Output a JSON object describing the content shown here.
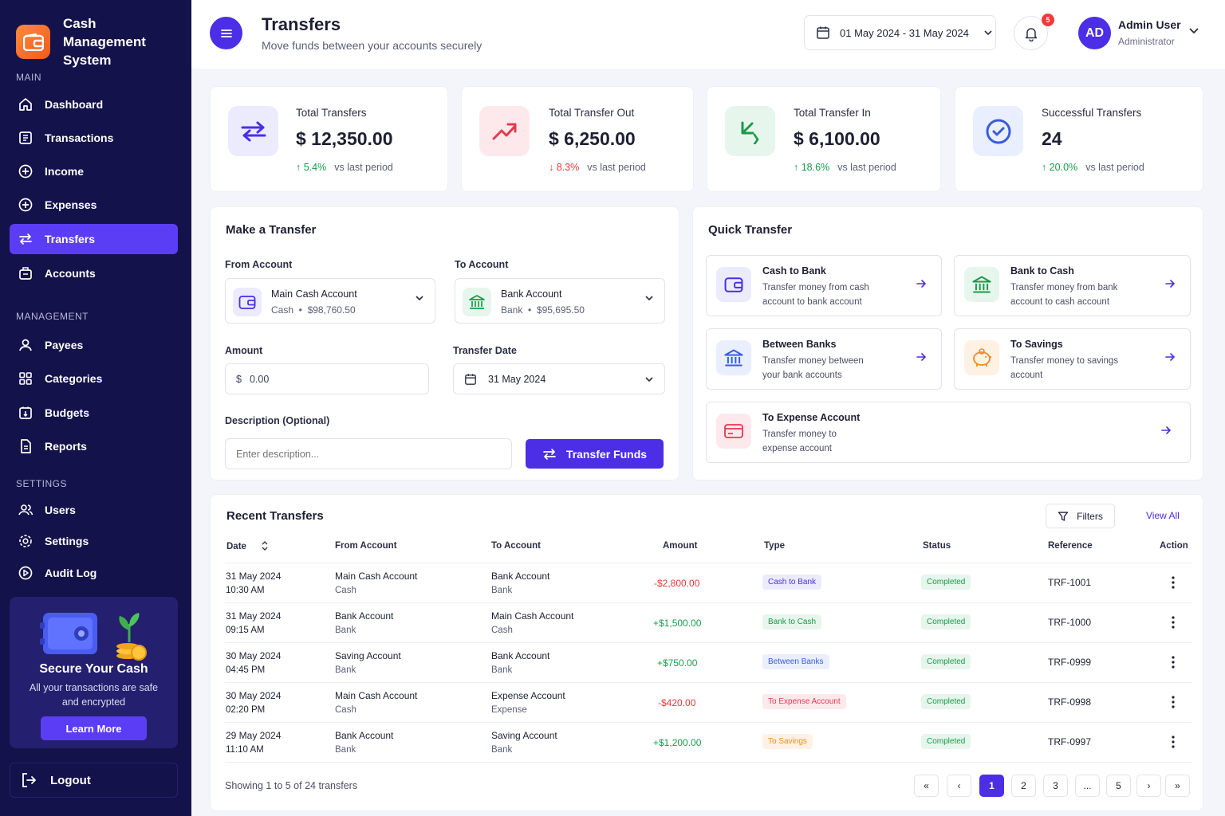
{
  "brand": {
    "name_line1": "Cash Management",
    "name_line2": "System"
  },
  "sidebar": {
    "sections": [
      "MAIN",
      "MANAGEMENT",
      "SETTINGS"
    ],
    "items": [
      {
        "label": "Dashboard",
        "icon": "home-icon"
      },
      {
        "label": "Transactions",
        "icon": "receipt-icon"
      },
      {
        "label": "Income",
        "icon": "plus-circle-icon"
      },
      {
        "label": "Expenses",
        "icon": "plus-circle-icon"
      },
      {
        "label": "Transfers",
        "icon": "transfer-icon",
        "active": true
      },
      {
        "label": "Accounts",
        "icon": "briefcase-icon"
      },
      {
        "label": "Payees",
        "icon": "user-icon"
      },
      {
        "label": "Categories",
        "icon": "grid-icon"
      },
      {
        "label": "Budgets",
        "icon": "budget-icon"
      },
      {
        "label": "Reports",
        "icon": "report-icon"
      },
      {
        "label": "Users",
        "icon": "users-icon"
      },
      {
        "label": "Settings",
        "icon": "gear-icon"
      },
      {
        "label": "Audit Log",
        "icon": "play-circle-icon"
      }
    ],
    "promo": {
      "title": "Secure Your Cash",
      "text": "All your transactions are safe and encrypted",
      "button": "Learn More"
    },
    "logout": "Logout"
  },
  "header": {
    "title": "Transfers",
    "subtitle": "Move funds between your accounts securely",
    "date_range": "01 May 2024 - 31 May 2024",
    "notification_count": "5",
    "user": {
      "initials": "AD",
      "name": "Admin User",
      "role": "Administrator"
    }
  },
  "stats": [
    {
      "label": "Total Transfers",
      "value": "$ 12,350.00",
      "change": "5.4%",
      "direction": "up",
      "vs": "vs last period",
      "icon": "swap-icon"
    },
    {
      "label": "Total Transfer Out",
      "value": "$ 6,250.00",
      "change": "8.3%",
      "direction": "down",
      "vs": "vs last period",
      "icon": "trending-up-icon"
    },
    {
      "label": "Total Transfer In",
      "value": "$ 6,100.00",
      "change": "18.6%",
      "direction": "up",
      "vs": "vs last period",
      "icon": "arrow-in-icon"
    },
    {
      "label": "Successful Transfers",
      "value": "24",
      "change": "20.0%",
      "direction": "up",
      "vs": "vs last period",
      "icon": "check-circle-icon"
    }
  ],
  "transfer_form": {
    "title": "Make a Transfer",
    "from_label": "From Account",
    "from": {
      "name": "Main Cash Account",
      "type": "Cash",
      "balance": "$98,760.50"
    },
    "to_label": "To Account",
    "to": {
      "name": "Bank Account",
      "type": "Bank",
      "balance": "$95,695.50"
    },
    "amount_label": "Amount",
    "currency": "$",
    "amount_value": "0.00",
    "date_label": "Transfer Date",
    "date_value": "31 May 2024",
    "desc_label": "Description (Optional)",
    "desc_placeholder": "Enter description...",
    "submit": "Transfer Funds"
  },
  "quick_transfer": {
    "title": "Quick Transfer",
    "items": [
      {
        "title": "Cash to Bank",
        "desc": "Transfer money from cash account to bank account",
        "icon": "wallet-icon"
      },
      {
        "title": "Bank to Cash",
        "desc": "Transfer money from bank account to cash account",
        "icon": "bank-icon"
      },
      {
        "title": "Between Banks",
        "desc": "Transfer money between your bank accounts",
        "icon": "bank-icon"
      },
      {
        "title": "To Savings",
        "desc": "Transfer money to savings account",
        "icon": "piggy-bank-icon"
      },
      {
        "title": "To Expense Account",
        "desc": "Transfer money to expense account",
        "icon": "card-icon"
      }
    ]
  },
  "recent": {
    "title": "Recent Transfers",
    "filters": "Filters",
    "view_all": "View All",
    "columns": [
      "Date",
      "From Account",
      "To Account",
      "Amount",
      "Type",
      "Status",
      "Reference",
      "Action"
    ],
    "rows": [
      {
        "date": "31 May 2024",
        "time": "10:30 AM",
        "from": "Main Cash Account",
        "from_type": "Cash",
        "to": "Bank Account",
        "to_type": "Bank",
        "amount": "-$2,800.00",
        "type": "Cash to Bank",
        "status": "Completed",
        "ref": "TRF-1001"
      },
      {
        "date": "31 May 2024",
        "time": "09:15 AM",
        "from": "Bank Account",
        "from_type": "Bank",
        "to": "Main Cash Account",
        "to_type": "Cash",
        "amount": "+$1,500.00",
        "type": "Bank to Cash",
        "status": "Completed",
        "ref": "TRF-1000"
      },
      {
        "date": "30 May 2024",
        "time": "04:45 PM",
        "from": "Saving Account",
        "from_type": "Bank",
        "to": "Bank Account",
        "to_type": "Bank",
        "amount": "+$750.00",
        "type": "Between Banks",
        "status": "Completed",
        "ref": "TRF-0999"
      },
      {
        "date": "30 May 2024",
        "time": "02:20 PM",
        "from": "Main Cash Account",
        "from_type": "Cash",
        "to": "Expense Account",
        "to_type": "Expense",
        "amount": "-$420.00",
        "type": "To Expense Account",
        "status": "Completed",
        "ref": "TRF-0998"
      },
      {
        "date": "29 May 2024",
        "time": "11:10 AM",
        "from": "Bank Account",
        "from_type": "Bank",
        "to": "Saving Account",
        "to_type": "Bank",
        "amount": "+$1,200.00",
        "type": "To Savings",
        "status": "Completed",
        "ref": "TRF-0997"
      }
    ],
    "footer": "Showing 1 to 5 of 24 transfers",
    "pagination": [
      "«",
      "‹",
      "1",
      "2",
      "3",
      "...",
      "5",
      "›",
      "»"
    ]
  },
  "colors": {
    "sidebar": "#14124a",
    "accent": "#4b2ee6",
    "positive": "#1a9a4a",
    "negative": "#e53935"
  }
}
